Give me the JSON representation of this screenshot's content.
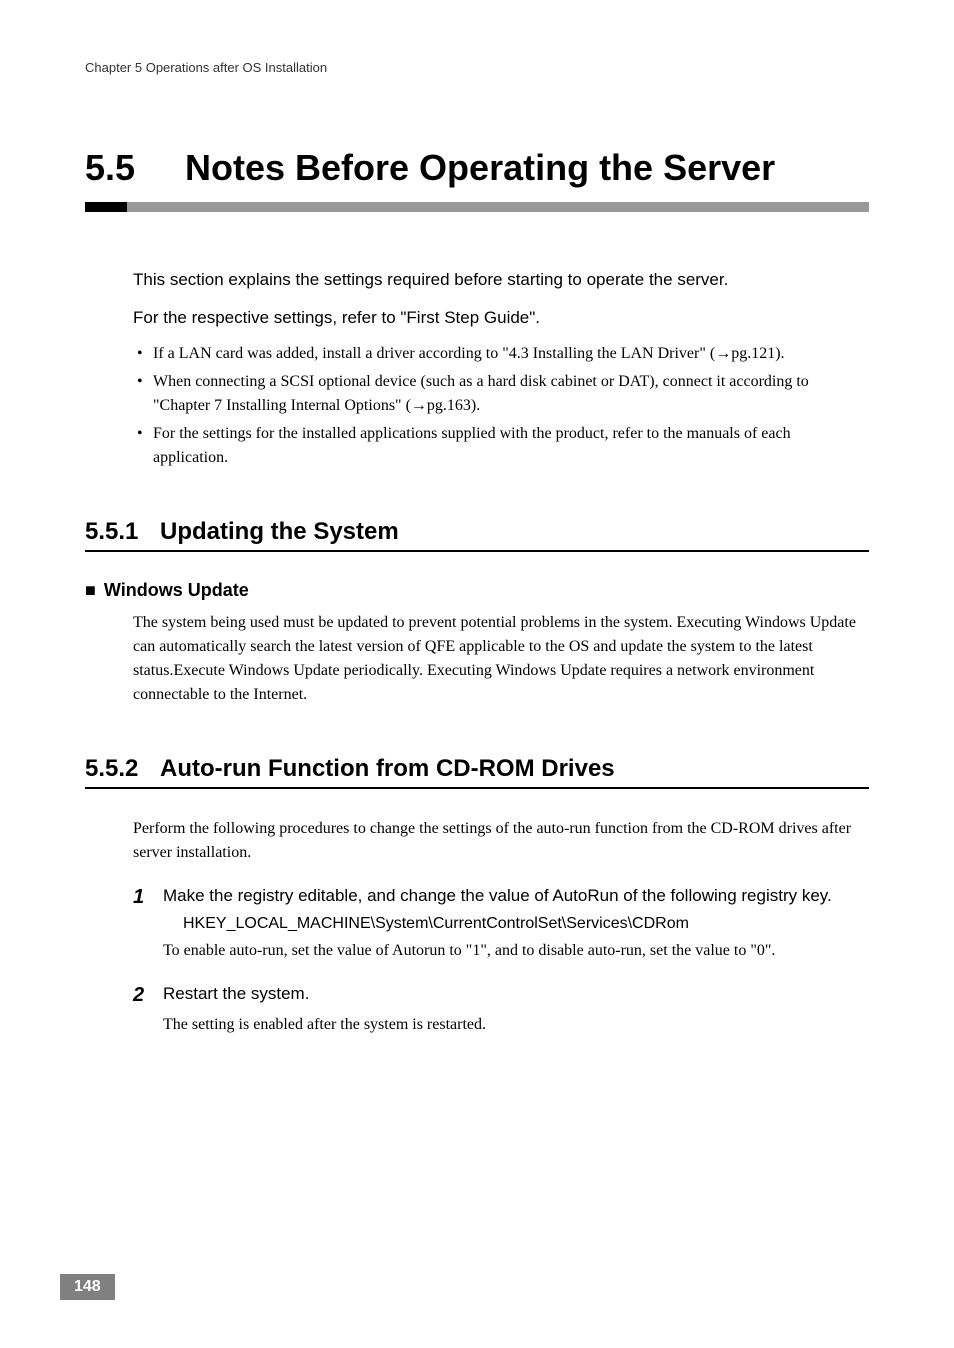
{
  "chapter_header": "Chapter 5  Operations after OS Installation",
  "main_title": {
    "number": "5.5",
    "text": "Notes Before Operating the Server"
  },
  "intro": {
    "line1": "This section explains the settings required before starting to operate the server.",
    "line2": "For the respective settings, refer to \"First Step Guide\"."
  },
  "bullets": [
    "If a LAN card was added, install a driver according to \"4.3 Installing the LAN Driver\" (→pg.121).",
    "When connecting a SCSI optional device (such as a hard disk cabinet or DAT), connect it according to \"Chapter 7 Installing Internal Options\" (→pg.163).",
    "For the settings for the installed applications supplied with the product, refer to the manuals of each application."
  ],
  "section551": {
    "number": "5.5.1",
    "title": "Updating the System",
    "subsection": {
      "title": "Windows Update",
      "body": "The system being used must be updated to prevent potential problems in the system. Executing Windows Update can automatically search the latest version of QFE applicable to the OS and update the system to the latest status.Execute Windows Update periodically. Executing Windows Update requires a network environment connectable to the Internet."
    }
  },
  "section552": {
    "number": "5.5.2",
    "title": "Auto-run Function from CD-ROM Drives",
    "intro": "Perform the following procedures to change the settings of the auto-run function from the CD-ROM drives after server installation.",
    "steps": [
      {
        "num": "1",
        "instruction": "Make the registry editable, and change the value of AutoRun of the following registry key.",
        "path": "HKEY_LOCAL_MACHINE\\System\\CurrentControlSet\\Services\\CDRom",
        "note": "To enable auto-run, set the value of Autorun to \"1\", and to disable auto-run, set the value to \"0\"."
      },
      {
        "num": "2",
        "instruction": "Restart the system.",
        "path": "",
        "note": "The setting is enabled after the system is restarted."
      }
    ]
  },
  "page_number": "148"
}
